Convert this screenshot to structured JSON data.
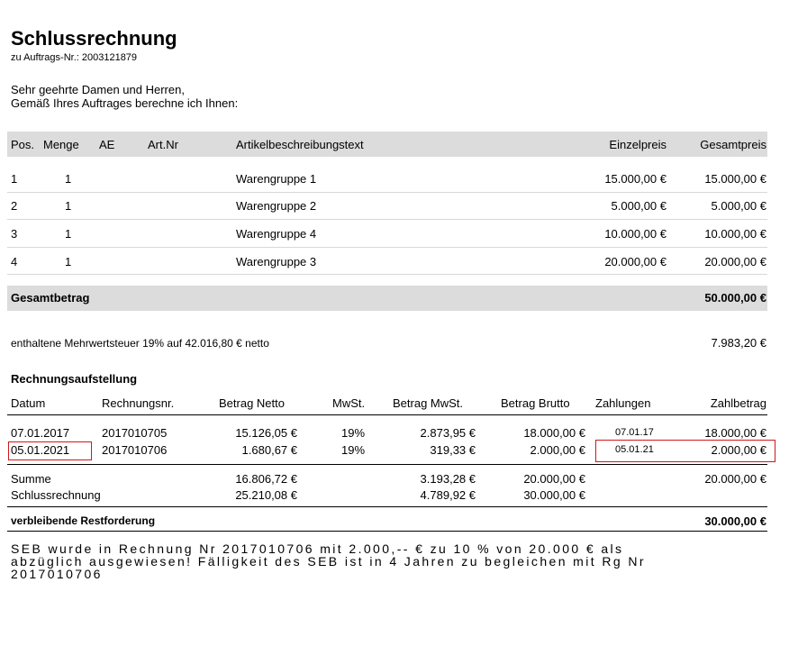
{
  "doc": {
    "title": "Schlussrechnung",
    "order_ref": "zu Auftrags-Nr.: 2003121879",
    "greeting_1": "Sehr geehrte Damen und Herren,",
    "greeting_2": "Gemäß Ihres Auftrages berechne ich Ihnen:"
  },
  "items_table": {
    "headers": {
      "pos": "Pos.",
      "menge": "Menge",
      "ae": "AE",
      "artnr": "Art.Nr",
      "beschreibung": "Artikelbeschreibungstext",
      "einzelpreis": "Einzelpreis",
      "gesamtpreis": "Gesamtpreis"
    },
    "rows": [
      {
        "pos": "1",
        "menge": "1",
        "beschreibung": "Warengruppe 1",
        "einzelpreis": "15.000,00 €",
        "gesamtpreis": "15.000,00 €"
      },
      {
        "pos": "2",
        "menge": "1",
        "beschreibung": "Warengruppe 2",
        "einzelpreis": "5.000,00 €",
        "gesamtpreis": "5.000,00 €"
      },
      {
        "pos": "3",
        "menge": "1",
        "beschreibung": "Warengruppe 4",
        "einzelpreis": "10.000,00 €",
        "gesamtpreis": "10.000,00 €"
      },
      {
        "pos": "4",
        "menge": "1",
        "beschreibung": "Warengruppe 3",
        "einzelpreis": "20.000,00 €",
        "gesamtpreis": "20.000,00 €"
      }
    ],
    "total_label": "Gesamtbetrag",
    "total_value": "50.000,00 €"
  },
  "vat": {
    "label": "enthaltene Mehrwertsteuer 19% auf 42.016,80 € netto",
    "value": "7.983,20 €"
  },
  "statement": {
    "title": "Rechnungsaufstellung",
    "headers": {
      "datum": "Datum",
      "rechnungsnr": "Rechnungsnr.",
      "netto": "Betrag Netto",
      "mwst": "MwSt.",
      "betrag_mwst": "Betrag MwSt.",
      "brutto": "Betrag Brutto",
      "zahlungen": "Zahlungen",
      "zahlbetrag": "Zahlbetrag"
    },
    "rows": [
      {
        "datum": "07.01.2017",
        "rechnungsnr": "2017010705",
        "netto": "15.126,05 €",
        "mwst": "19%",
        "betrag_mwst": "2.873,95 €",
        "brutto": "18.000,00 €",
        "zahlungen": "07.01.17",
        "zahlbetrag": "18.000,00 €"
      },
      {
        "datum": "05.01.2021",
        "rechnungsnr": "2017010706",
        "netto": "1.680,67 €",
        "mwst": "19%",
        "betrag_mwst": "319,33 €",
        "brutto": "2.000,00 €",
        "zahlungen": "05.01.21",
        "zahlbetrag": "2.000,00 €"
      }
    ],
    "summe": {
      "label": "Summe",
      "netto": "16.806,72 €",
      "betrag_mwst": "3.193,28 €",
      "brutto": "20.000,00 €",
      "zahlbetrag": "20.000,00 €"
    },
    "schluss": {
      "label": "Schlussrechnung",
      "netto": "25.210,08 €",
      "betrag_mwst": "4.789,92 €",
      "brutto": "30.000,00 €"
    },
    "rest": {
      "label": "verbleibende Restforderung",
      "value": "30.000,00 €"
    }
  },
  "note": {
    "line1": "SEB wurde in Rechnung Nr 2017010706 mit 2.000,-- € zu 10 % von 20.000  € als",
    "line2": "abzüglich ausgewiesen! Fälligkeit des SEB ist in 4 Jahren zu begleichen mit Rg Nr",
    "line3": "2017010706"
  },
  "highlight_color": "#d01818"
}
